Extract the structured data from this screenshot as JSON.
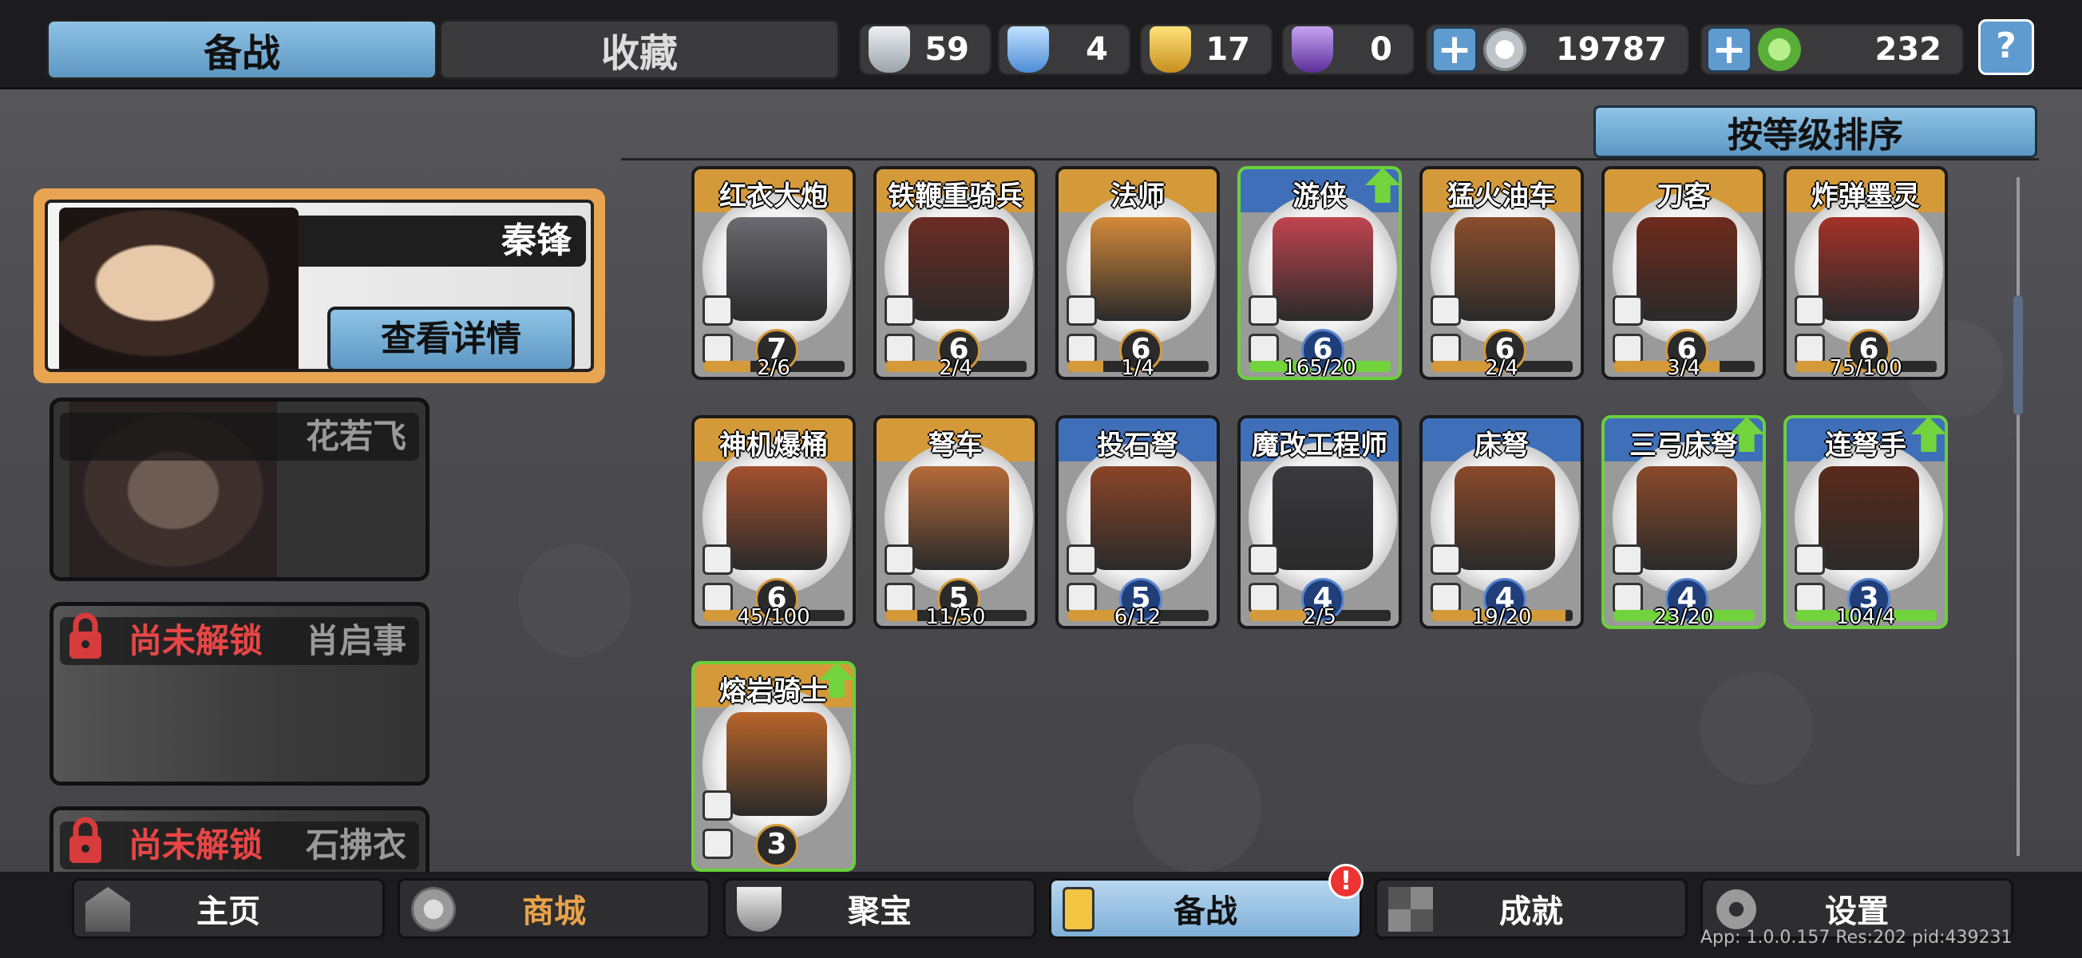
{
  "tabs": {
    "prepare": "备战",
    "collection": "收藏"
  },
  "resources": [
    {
      "name": "silver-medal",
      "value": "59",
      "color": "#c9ced3"
    },
    {
      "name": "blue-crystal",
      "value": "4",
      "color": "#7fb6ea"
    },
    {
      "name": "gold-medal",
      "value": "17",
      "color": "#e1b53a"
    },
    {
      "name": "purple-gem",
      "value": "0",
      "color": "#8a5ad0"
    }
  ],
  "currency": {
    "silver_coin": "19787",
    "jade_coin": "232"
  },
  "help_label": "?",
  "sort_label": "按等级排序",
  "heroes": {
    "selected": {
      "name": "秦锋",
      "detail_button": "查看详情"
    },
    "second": {
      "name": "花若飞"
    },
    "locked1": {
      "status": "尚未解锁",
      "name": "肖启事"
    },
    "locked2": {
      "status": "尚未解锁",
      "name": "石拂衣"
    }
  },
  "units": [
    {
      "name": "红衣大炮",
      "level": "7",
      "progress": "2/6",
      "fill": 0.33,
      "color": "#6a6a70"
    },
    {
      "name": "铁鞭重骑兵",
      "level": "6",
      "progress": "2/4",
      "fill": 0.5,
      "color": "#6b2c24"
    },
    {
      "name": "法师",
      "level": "6",
      "progress": "1/4",
      "fill": 0.25,
      "color": "#d48a3a"
    },
    {
      "name": "游侠",
      "level": "6",
      "progress": "165/20",
      "fill": 1,
      "color": "#c0444f"
    },
    {
      "name": "猛火油车",
      "level": "6",
      "progress": "2/4",
      "fill": 0.5,
      "color": "#8b4e2c"
    },
    {
      "name": "刀客",
      "level": "6",
      "progress": "3/4",
      "fill": 0.75,
      "color": "#6e2a1c"
    },
    {
      "name": "炸弹墨灵",
      "level": "6",
      "progress": "75/100",
      "fill": 0.75,
      "color": "#a33228"
    },
    {
      "name": "神机爆桶",
      "level": "6",
      "progress": "45/100",
      "fill": 0.45,
      "color": "#a4502e"
    },
    {
      "name": "弩车",
      "level": "5",
      "progress": "11/50",
      "fill": 0.22,
      "color": "#b56a3a"
    },
    {
      "name": "投石弩",
      "level": "5",
      "progress": "6/12",
      "fill": 0.5,
      "color": "#8a4528"
    },
    {
      "name": "魔改工程师",
      "level": "4",
      "progress": "2/5",
      "fill": 0.4,
      "color": "#3a3a3e"
    },
    {
      "name": "床弩",
      "level": "4",
      "progress": "19/20",
      "fill": 0.95,
      "color": "#8a4a2a"
    },
    {
      "name": "三弓床弩",
      "level": "4",
      "progress": "23/20",
      "fill": 1,
      "color": "#8a4a2a"
    },
    {
      "name": "连弩手",
      "level": "3",
      "progress": "104/4",
      "fill": 1,
      "color": "#5a2a1c"
    },
    {
      "name": "熔岩骑士",
      "level": "3",
      "progress": "",
      "fill": 0,
      "color": "#b8642a"
    }
  ],
  "nav": {
    "home": "主页",
    "shop": "商城",
    "treasure": "聚宝",
    "prepare": "备战",
    "achievements": "成就",
    "settings": "设置"
  },
  "nav_badge": "!",
  "version": "App: 1.0.0.157 Res:202 pid:439231"
}
